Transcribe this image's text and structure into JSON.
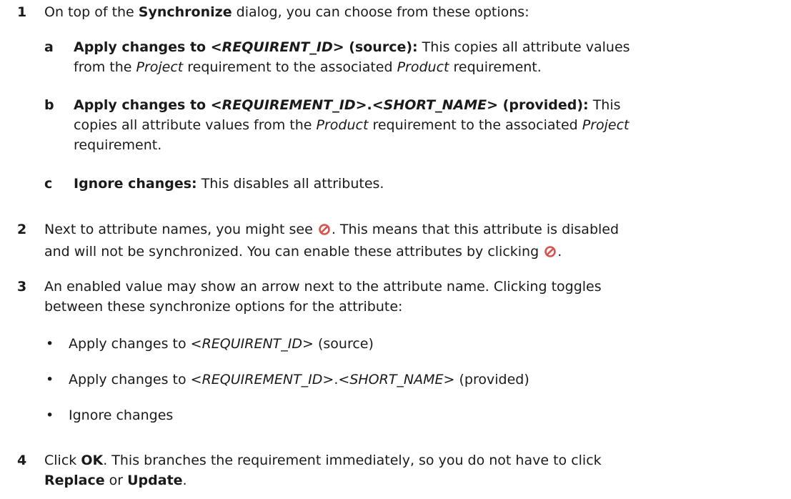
{
  "step1": {
    "num": "1",
    "t1": "On top of the ",
    "b1": "Synchronize",
    "t2": " dialog, you can choose from these options:",
    "a": {
      "letter": "a",
      "b1": "Apply changes to <",
      "bi1": "REQUIRENT_ID",
      "b2": "> (source):",
      "t1": " This copies all attribute values",
      "t2": "from the ",
      "i1": "Project",
      "t3": " requirement to the associated ",
      "i2": "Product",
      "t4": " requirement."
    },
    "b": {
      "letter": "b",
      "b1": "Apply changes to <",
      "bi1": "REQUIREMENT_ID",
      "b2": ">.<",
      "bi2": "SHORT_NAME",
      "b3": "> (provided):",
      "t1": " This",
      "t2": "copies all attribute values from the ",
      "i1": "Product",
      "t3": " requirement to the associated ",
      "i2": "Project",
      "t4": "requirement."
    },
    "c": {
      "letter": "c",
      "b1": "Ignore changes:",
      "t1": " This disables all attributes."
    }
  },
  "step2": {
    "num": "2",
    "t1": "Next to attribute names, you might see ",
    "t2": ". This means that this attribute is disabled",
    "t3": "and will not be synchronized. You can enable these attributes by clicking ",
    "t4": ".",
    "icon": "disabled-icon",
    "icon_color": "#d9534f"
  },
  "step3": {
    "num": "3",
    "t1": "An enabled value may show an arrow next to the attribute name. Clicking toggles",
    "t2": "between these synchronize options for the attribute:",
    "bullet_char": "•",
    "bullets": [
      {
        "p1": "Apply changes to <",
        "i1": "REQUIRENT_ID",
        "p2": "> (source)"
      },
      {
        "p1": "Apply changes to <",
        "i1": "REQUIREMENT_ID",
        "p2": ">.<",
        "i2": "SHORT_NAME",
        "p3": "> (provided)"
      },
      {
        "p1": "Ignore changes"
      }
    ]
  },
  "step4": {
    "num": "4",
    "t1": "Click ",
    "b1": "OK",
    "t2": ". This branches the requirement immediately, so you do not have to click",
    "b2": "Replace",
    "t3": " or ",
    "b3": "Update",
    "t4": "."
  }
}
